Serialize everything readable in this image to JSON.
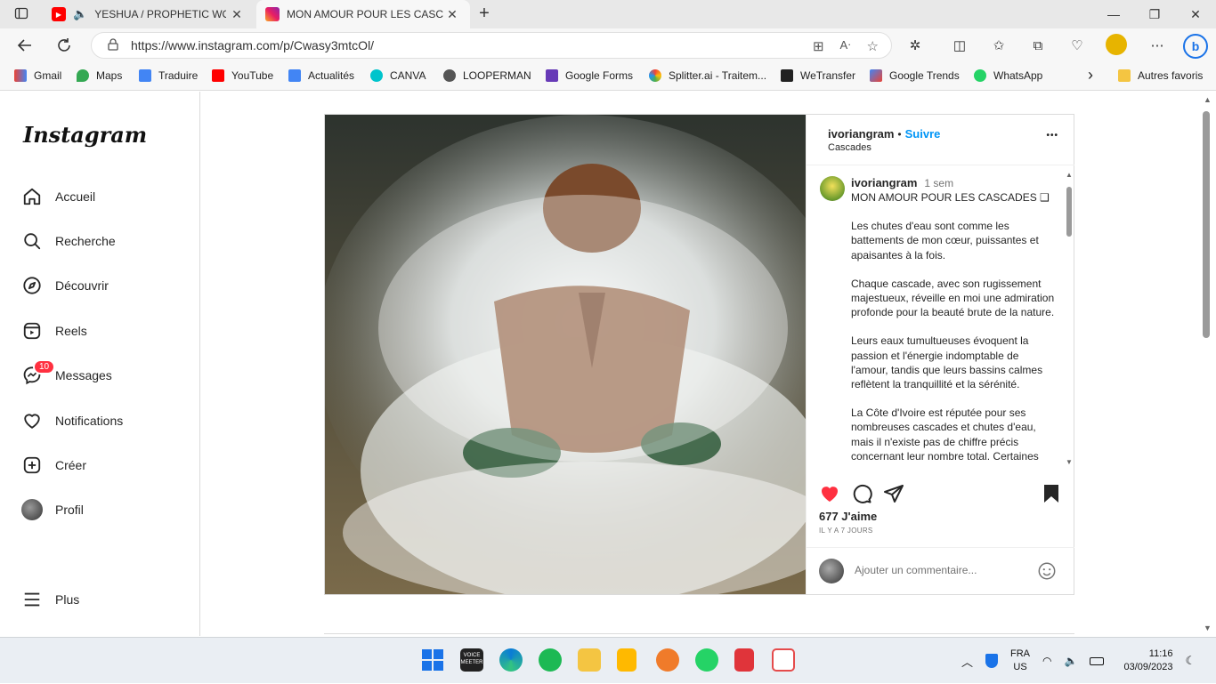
{
  "browser": {
    "tabs": [
      {
        "title": "YESHUA / PROPHETIC WOR",
        "close": "✕"
      },
      {
        "title": "MON AMOUR POUR LES CASCAD",
        "close": "✕"
      }
    ],
    "new_tab": "+",
    "window_controls": {
      "minimize": "—",
      "maximize": "❐",
      "close": "✕"
    },
    "url": "https://www.instagram.com/p/Cwasy3mtcOl/",
    "bookmarks": [
      "Gmail",
      "Maps",
      "Traduire",
      "YouTube",
      "Actualités",
      "CANVA",
      "LOOPERMAN",
      "Google Forms",
      "Splitter.ai - Traitem...",
      "WeTransfer",
      "Google Trends",
      "WhatsApp"
    ],
    "bookmarks_more": "›",
    "other_favorites": "Autres favoris"
  },
  "instagram": {
    "logo": "Instagram",
    "nav": [
      {
        "label": "Accueil",
        "icon": "home-icon"
      },
      {
        "label": "Recherche",
        "icon": "search-icon"
      },
      {
        "label": "Découvrir",
        "icon": "compass-icon"
      },
      {
        "label": "Reels",
        "icon": "reels-icon"
      },
      {
        "label": "Messages",
        "icon": "messenger-icon",
        "badge": "10"
      },
      {
        "label": "Notifications",
        "icon": "heart-icon"
      },
      {
        "label": "Créer",
        "icon": "plus-square-icon"
      },
      {
        "label": "Profil",
        "icon": "avatar"
      }
    ],
    "more": "Plus"
  },
  "post": {
    "header": {
      "username": "ivoriangram",
      "separator": "•",
      "follow": "Suivre",
      "location": "Cascades",
      "more": "•••"
    },
    "caption": {
      "username": "ivoriangram",
      "time": "1 sem",
      "title": "MON AMOUR POUR LES CASCADES ❑",
      "paragraphs": [
        "Les chutes d'eau sont comme les battements de mon cœur, puissantes et apaisantes à la fois.",
        "Chaque cascade, avec son rugissement majestueux, réveille en moi une admiration profonde pour la beauté brute de la nature.",
        "Leurs eaux tumultueuses évoquent la passion et l'énergie indomptable de l'amour, tandis que leurs bassins calmes reflètent la tranquillité et la sérénité.",
        "La Côte d'Ivoire est réputée pour ses nombreuses cascades et chutes d'eau, mais il n'existe pas de chiffre précis concernant leur nombre total. Certaines"
      ]
    },
    "likes": "677 J'aime",
    "date": "IL Y A 7 JOURS",
    "comment_placeholder": "Ajouter un commentaire...",
    "liked": true,
    "saved": true
  },
  "taskbar": {
    "lang": "FRA",
    "region": "US",
    "time": "11:16",
    "date": "03/09/2023",
    "voicemeeter": "VOICE\nMEETER"
  }
}
